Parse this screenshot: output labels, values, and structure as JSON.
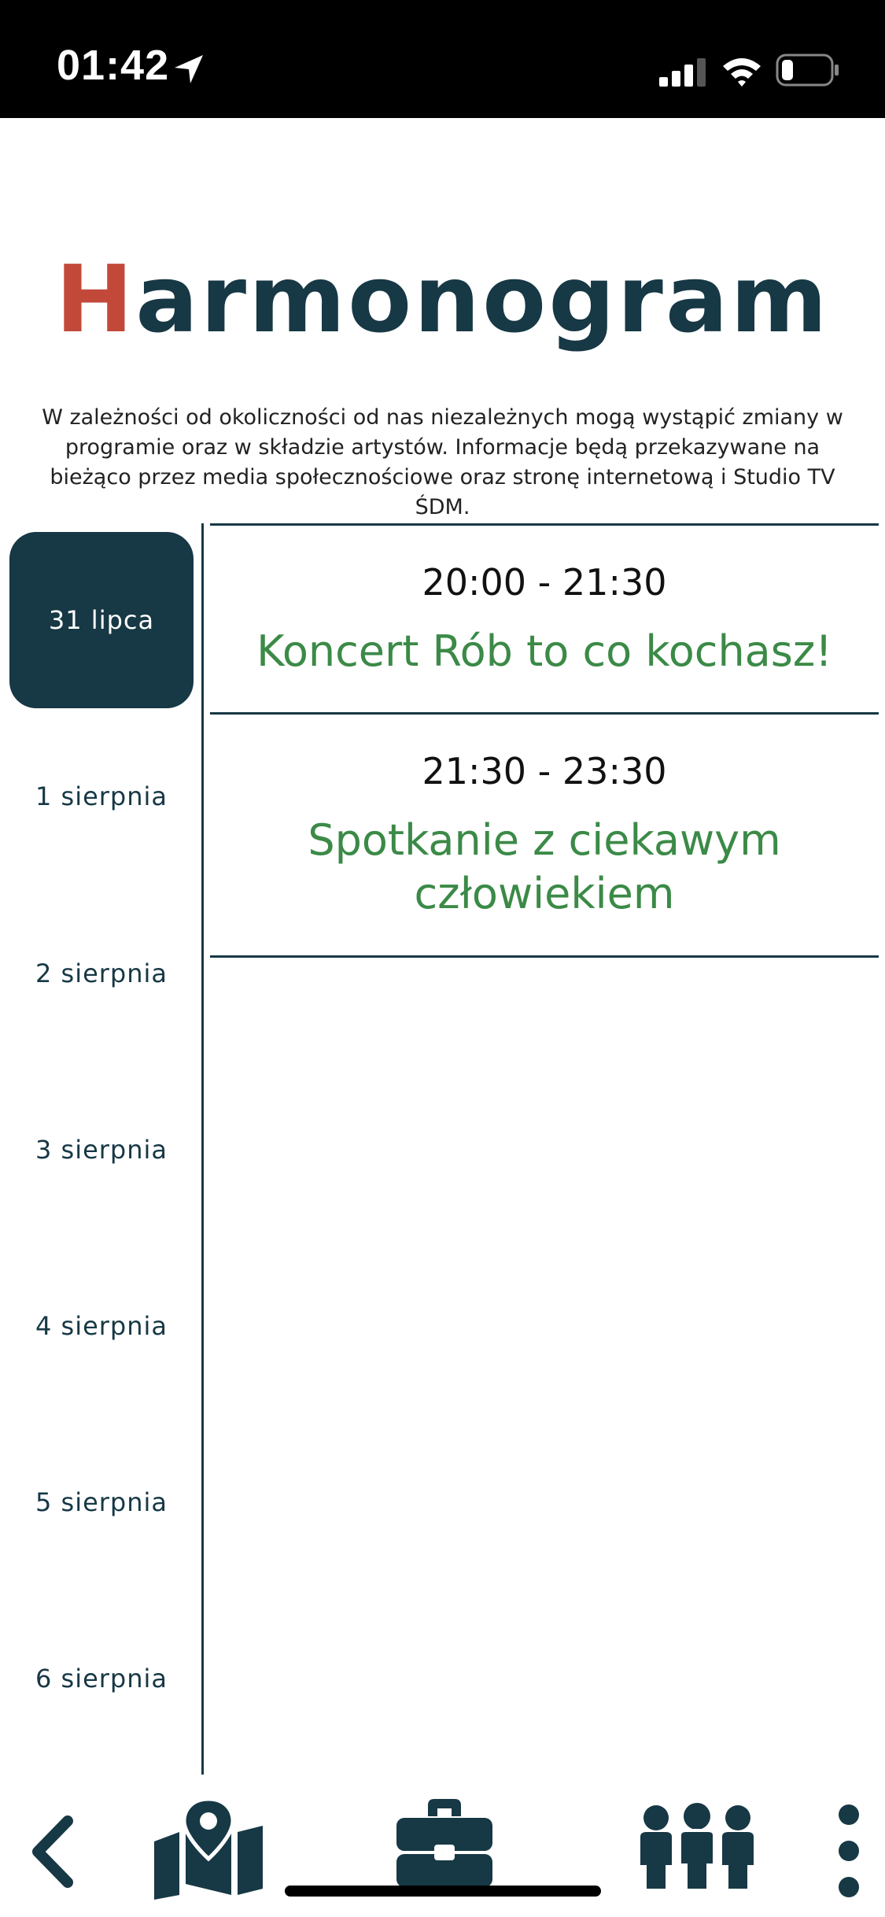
{
  "status_bar": {
    "time": "01:42",
    "icons": [
      "location-arrow-icon",
      "signal-icon",
      "wifi-icon",
      "battery-icon"
    ]
  },
  "header": {
    "title_first_letter": "H",
    "title_rest": "armonogram",
    "notice": "W zależności od okoliczności od nas niezależnych mogą wystąpić zmiany w programie oraz w składzie artystów. Informacje będą przekazywane na bieżąco przez media społecznościowe oraz stronę internetową i Studio TV ŚDM."
  },
  "days": [
    {
      "label": "31 lipca",
      "active": true
    },
    {
      "label": "1 sierpnia",
      "active": false
    },
    {
      "label": "2 sierpnia",
      "active": false
    },
    {
      "label": "3 sierpnia",
      "active": false
    },
    {
      "label": "4 sierpnia",
      "active": false
    },
    {
      "label": "5 sierpnia",
      "active": false
    },
    {
      "label": "6 sierpnia",
      "active": false
    }
  ],
  "events": [
    {
      "time": "20:00 - 21:30",
      "name": "Koncert Rób to co kochasz!"
    },
    {
      "time": "21:30 - 23:30",
      "name": "Spotkanie z ciekawym człowiekiem"
    }
  ],
  "bottom_nav": {
    "items": [
      "back-icon",
      "map-icon",
      "briefcase-icon",
      "people-icon",
      "more-vertical-icon"
    ]
  },
  "colors": {
    "primary": "#173845",
    "accent_red": "#c2493a",
    "event_green": "#3b8a47"
  }
}
